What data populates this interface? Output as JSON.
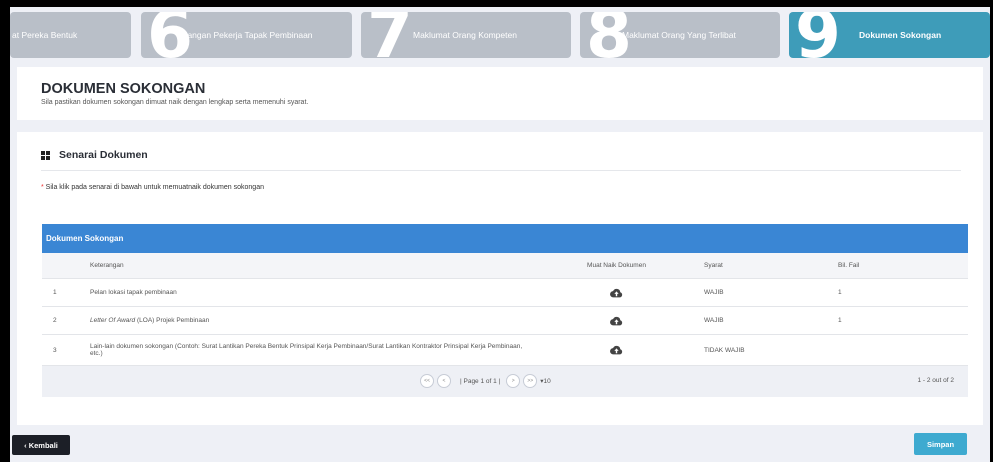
{
  "steps": [
    {
      "number": "",
      "label": "at Pereka Bentuk"
    },
    {
      "number": "6",
      "label": "Bilangan Pekerja Tapak Pembinaan"
    },
    {
      "number": "7",
      "label": "Maklumat Orang Kompeten"
    },
    {
      "number": "8",
      "label": "Maklumat Orang Yang Terlibat"
    },
    {
      "number": "9",
      "label": "Dokumen Sokongan"
    }
  ],
  "header": {
    "title": "DOKUMEN SOKONGAN",
    "subtitle": "Sila pastikan dokumen sokongan dimuat naik dengan lengkap serta memenuhi syarat."
  },
  "section": {
    "title": "Senarai Dokumen",
    "note_star": "*",
    "note": " Sila klik pada senarai di bawah untuk memuatnaik dokumen sokongan"
  },
  "table": {
    "title": "Dokumen Sokongan",
    "columns": [
      "",
      "Keterangan",
      "Muat Naik Dokumen",
      "Syarat",
      "Bil. Fail"
    ],
    "rows": [
      {
        "no": "1",
        "desc_italic": "",
        "desc": "Pelan lokasi tapak pembinaan",
        "syarat": "WAJIB",
        "bil": "1"
      },
      {
        "no": "2",
        "desc_italic": "Letter Of Award",
        "desc": " (LOA) Projek Pembinaan",
        "syarat": "WAJIB",
        "bil": "1"
      },
      {
        "no": "3",
        "desc_italic": "",
        "desc": "Lain-lain dokumen sokongan (Contoh: Surat Lantikan Pereka Bentuk Prinsipal Kerja Pembinaan/Surat Lantikan Kontraktor Prinsipal Kerja Pembinaan, etc.)",
        "syarat": "TIDAK WAJIB",
        "bil": ""
      }
    ],
    "upload_icon": "cloud-upload-icon"
  },
  "pager": {
    "first": "<<",
    "prev": "<",
    "page_text": "| Page 1 of 1 |",
    "next": ">",
    "last": ">>",
    "page_size": "▾10",
    "range": "1 - 2 out of 2"
  },
  "buttons": {
    "back": "‹ Kembali",
    "save": "Simpan"
  },
  "colors": {
    "active_step": "#3e9cb9",
    "inactive_step": "#b9bfc8",
    "table_header": "#3a86d4",
    "save_button": "#3eaad0",
    "back_button": "#1c1f27"
  }
}
